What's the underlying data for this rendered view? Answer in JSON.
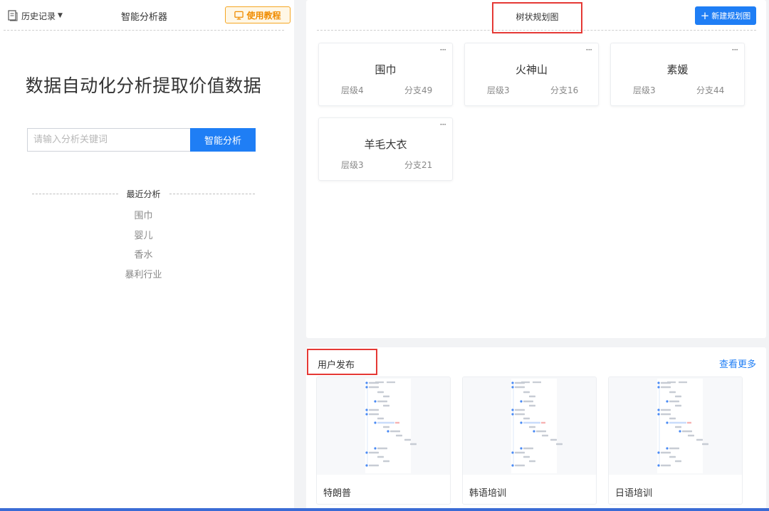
{
  "left_panel": {
    "history_label": "历史记录",
    "title": "智能分析器",
    "tutorial_label": "使用教程",
    "hero_text": "数据自动化分析提取价值数据",
    "search": {
      "placeholder": "请输入分析关键词",
      "value": "",
      "button_label": "智能分析"
    },
    "recent": {
      "label": "最近分析",
      "items": [
        "围巾",
        "婴儿",
        "香水",
        "暴利行业"
      ]
    }
  },
  "tree_panel": {
    "title": "树状规划图",
    "new_button_label": "新建规划图",
    "cards": [
      {
        "name": "围巾",
        "level": "层级4",
        "branches": "分支49"
      },
      {
        "name": "火神山",
        "level": "层级3",
        "branches": "分支16"
      },
      {
        "name": "素媛",
        "level": "层级3",
        "branches": "分支44"
      },
      {
        "name": "羊毛大衣",
        "level": "层级3",
        "branches": "分支21"
      }
    ]
  },
  "publish_panel": {
    "title": "用户发布",
    "more_label": "查看更多",
    "items": [
      {
        "name": "特朗普"
      },
      {
        "name": "韩语培训"
      },
      {
        "name": "日语培训"
      }
    ]
  },
  "icons": {
    "history": "document-icon",
    "tutorial": "monitor-icon",
    "more": "ellipsis-icon",
    "add": "plus-icon"
  },
  "colors": {
    "primary": "#1f7ef5",
    "tutorial_border": "#f5a623",
    "tutorial_text": "#f08c00",
    "highlight_box": "#e53935"
  }
}
